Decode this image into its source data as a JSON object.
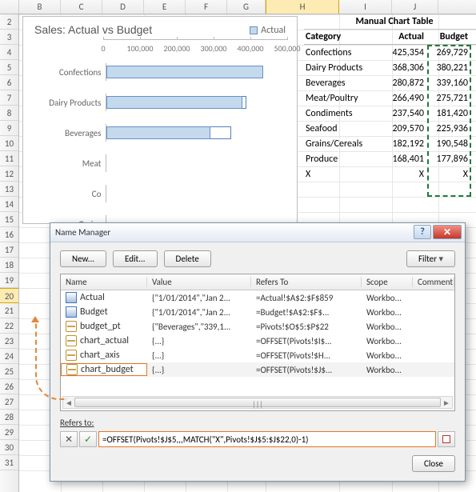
{
  "columns": [
    {
      "label": "B",
      "w": 52
    },
    {
      "label": "C",
      "w": 52
    },
    {
      "label": "D",
      "w": 52
    },
    {
      "label": "E",
      "w": 52
    },
    {
      "label": "F",
      "w": 52
    },
    {
      "label": "G",
      "w": 48
    },
    {
      "label": "H",
      "w": 92
    },
    {
      "label": "I",
      "w": 66
    },
    {
      "label": "J",
      "w": 58
    }
  ],
  "sel_col_index": 6,
  "rows_start": 2,
  "rows_end": 31,
  "sel_row": 20,
  "chart": {
    "title": "Sales: Actual vs Budget",
    "legend": "Actual",
    "x_ticks": [
      "0",
      "100,000",
      "200,000",
      "300,000",
      "400,000",
      "500,000"
    ],
    "bars_category_labels": [
      "Confections",
      "Dairy Products",
      "Beverages",
      "Meat",
      "Co",
      "Grains"
    ]
  },
  "chart_data": {
    "type": "bar",
    "orientation": "horizontal",
    "title": "Sales: Actual vs Budget",
    "xlabel": "",
    "ylabel": "",
    "xlim": [
      0,
      500000
    ],
    "categories": [
      "Confections",
      "Dairy Products",
      "Beverages"
    ],
    "series": [
      {
        "name": "Actual",
        "values": [
          425354,
          368306,
          280872
        ]
      },
      {
        "name": "Budget",
        "values": [
          269729,
          380221,
          339160
        ]
      }
    ],
    "legend": [
      "Actual"
    ]
  },
  "table": {
    "title": "Manual Chart Table",
    "headers": {
      "cat": "Category",
      "act": "Actual",
      "bud": "Budget"
    },
    "rows": [
      {
        "cat": "Confections",
        "act": "425,354",
        "bud": "269,729"
      },
      {
        "cat": "Dairy Products",
        "act": "368,306",
        "bud": "380,221"
      },
      {
        "cat": "Beverages",
        "act": "280,872",
        "bud": "339,160"
      },
      {
        "cat": "Meat/Poultry",
        "act": "266,490",
        "bud": "275,721"
      },
      {
        "cat": "Condiments",
        "act": "237,540",
        "bud": "181,420"
      },
      {
        "cat": "Seafood",
        "act": "209,570",
        "bud": "225,936"
      },
      {
        "cat": "Grains/Cereals",
        "act": "182,192",
        "bud": "190,548"
      },
      {
        "cat": "Produce",
        "act": "168,401",
        "bud": "177,896"
      },
      {
        "cat": "X",
        "act": "X",
        "bud": "X"
      }
    ]
  },
  "dialog": {
    "title": "Name Manager",
    "btn_new": "New...",
    "btn_edit": "Edit...",
    "btn_delete": "Delete",
    "btn_filter": "Filter",
    "btn_close": "Close",
    "headers": {
      "name": "Name",
      "value": "Value",
      "refers": "Refers To",
      "scope": "Scope",
      "comment": "Comment"
    },
    "rows": [
      {
        "icon": "tbl",
        "name": "Actual",
        "value": "{\"1/01/2014\",\"Jan 2...",
        "refers": "=Actual!$A$2:$F$859",
        "scope": "Workbo..."
      },
      {
        "icon": "tbl",
        "name": "Budget",
        "value": "{\"1/01/2014\",\"Jan 2...",
        "refers": "=Budget!$A$2:$F$...",
        "scope": "Workbo..."
      },
      {
        "icon": "nm",
        "name": "budget_pt",
        "value": "{\"Beverages\",\"339,1...",
        "refers": "=Pivots!$O$5:$P$22",
        "scope": "Workbo..."
      },
      {
        "icon": "nm",
        "name": "chart_actual",
        "value": "{...}",
        "refers": "=OFFSET(Pivots!$I$...",
        "scope": "Workbo..."
      },
      {
        "icon": "nm",
        "name": "chart_axis",
        "value": "{...}",
        "refers": "=OFFSET(Pivots!$H...",
        "scope": "Workbo..."
      },
      {
        "icon": "nm",
        "name": "chart_budget",
        "value": "{...}",
        "refers": "=OFFSET(Pivots!$J$...",
        "scope": "Workbo..."
      }
    ],
    "selected_row": 5,
    "refers_label": "Refers to:",
    "refers_value": "=OFFSET(Pivots!$J$5,,,MATCH(\"X\",Pivots!$J$5:$J$22,0)-1)",
    "btn_cancel_sym": "✕",
    "btn_accept_sym": "✓"
  }
}
